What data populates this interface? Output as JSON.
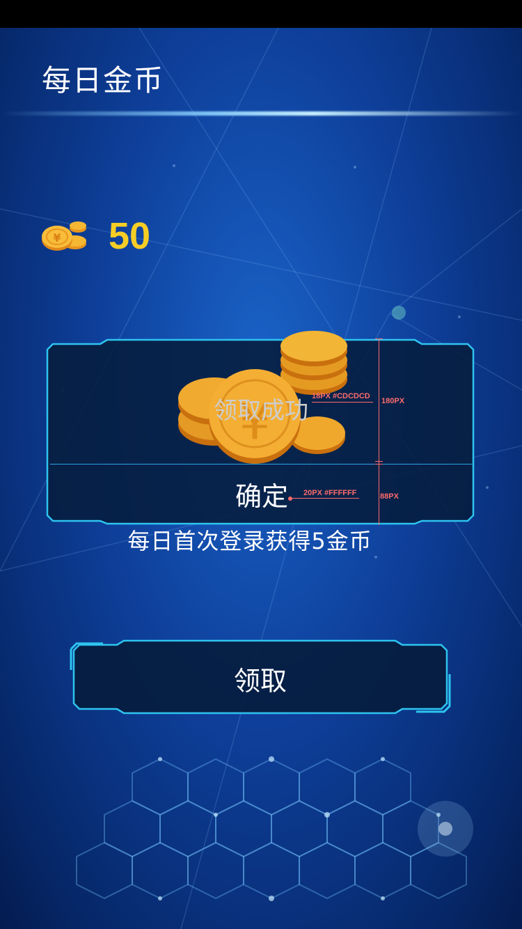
{
  "header": {
    "title": "每日金币"
  },
  "wallet": {
    "coin_icon": "coin-stack-icon",
    "count": "50"
  },
  "dialog": {
    "title": "领取成功",
    "confirm_label": "确定",
    "annotations": {
      "title_spec": "18PX #CDCDCD",
      "height_spec": "180PX",
      "button_spec": "20PX #FFFFFF",
      "button_height_spec": "88PX"
    }
  },
  "reward": {
    "description": "每日首次登录获得5金币"
  },
  "claim_button": {
    "label": "领取"
  },
  "colors": {
    "accent": "#2ea4ea",
    "coin": "#f5cd25",
    "title_gray": "#cdcdcd",
    "annotation": "#ff6b6b"
  }
}
